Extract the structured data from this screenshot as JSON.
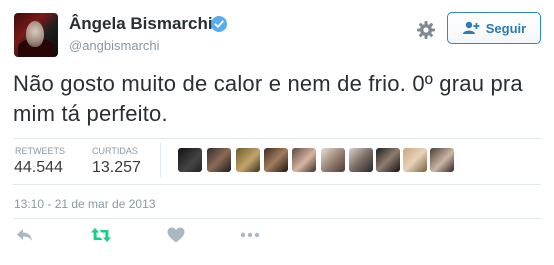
{
  "author": {
    "display_name": "Ângela Bismarchi",
    "handle": "@angbismarchi",
    "verified": true
  },
  "follow_button": {
    "label": "Seguir",
    "icon": "add-user-icon"
  },
  "settings_icon": "gear-icon",
  "tweet": {
    "text": "Não gosto muito de calor e nem de frio. 0º grau pra mim tá perfeito."
  },
  "stats": {
    "retweets_label": "RETWEETS",
    "retweets_value": "44.544",
    "likes_label": "CURTIDAS",
    "likes_value": "13.257"
  },
  "liker_avatars_count": 10,
  "timestamp": "13:10 - 21 de mar de 2013",
  "actions": [
    "reply-icon",
    "retweet-icon",
    "like-icon",
    "more-icon"
  ],
  "colors": {
    "accent": "#2b7bb9",
    "retweet_green": "#19cf86",
    "muted": "#8899a6",
    "text": "#292f33"
  }
}
